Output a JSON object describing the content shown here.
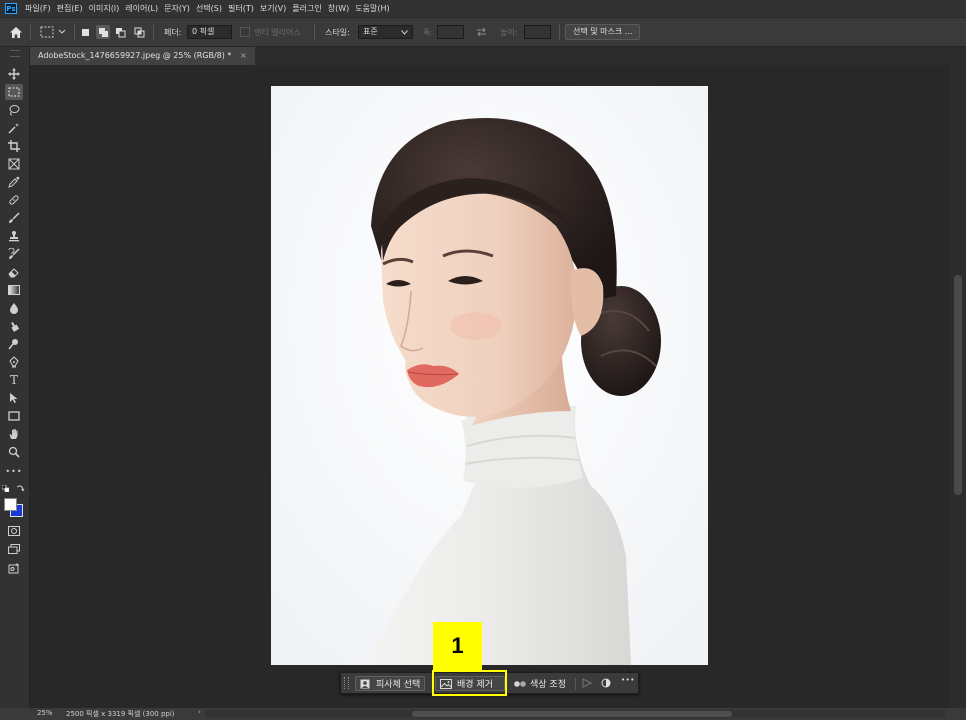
{
  "menu": {
    "logo": "Ps",
    "items": [
      "파일(F)",
      "편집(E)",
      "이미지(I)",
      "레이어(L)",
      "문자(Y)",
      "선택(S)",
      "필터(T)",
      "보기(V)",
      "플러그인",
      "창(W)",
      "도움말(H)"
    ]
  },
  "options": {
    "feather_label": "페더:",
    "feather_value": "0 픽셀",
    "antialias_label": "앤티 앨리어스",
    "style_label": "스타일:",
    "style_value": "표준",
    "width_label": "폭:",
    "height_label": "높이:",
    "select_mask_label": "선택 및 마스크 ..."
  },
  "document": {
    "tab_title": "AdobeStock_1476659927.jpeg @ 25% (RGB/8) *",
    "close": "×"
  },
  "contextbar": {
    "select_subject": "피사체 선택",
    "remove_background": "배경 제거",
    "color_adjust": "색상 조정",
    "more": "•••"
  },
  "annotation": {
    "step_number": "1",
    "color": "#ffff00"
  },
  "status": {
    "zoom": "25%",
    "doc_info": "2500 픽셀 x 3319 픽셀 (300 ppi)"
  },
  "colors": {
    "foreground": "#ffffff",
    "background": "#1a3ad6"
  }
}
